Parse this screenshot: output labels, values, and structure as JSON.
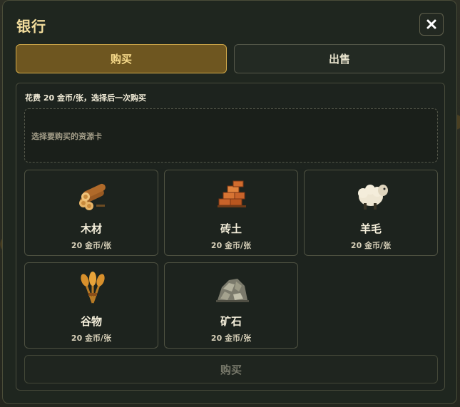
{
  "dialog": {
    "title": "银行"
  },
  "tabs": [
    {
      "label": "购买",
      "active": true
    },
    {
      "label": "出售",
      "active": false
    }
  ],
  "hint_text": "花费 20 金币/张，选择后一次购买",
  "dropzone_text": "选择要购买的资源卡",
  "resources": [
    {
      "name": "木材",
      "price": "20 金币/张",
      "icon": "wood-logs-icon"
    },
    {
      "name": "砖土",
      "price": "20 金币/张",
      "icon": "brick-icon"
    },
    {
      "name": "羊毛",
      "price": "20 金币/张",
      "icon": "sheep-icon"
    },
    {
      "name": "谷物",
      "price": "20 金币/张",
      "icon": "wheat-icon"
    },
    {
      "name": "矿石",
      "price": "20 金币/张",
      "icon": "ore-icon"
    }
  ],
  "buy_button_label": "购买",
  "colors": {
    "accent_gold": "#d1a94a",
    "title_gold": "#f3dd9c",
    "panel_bg": "#1d231e"
  }
}
